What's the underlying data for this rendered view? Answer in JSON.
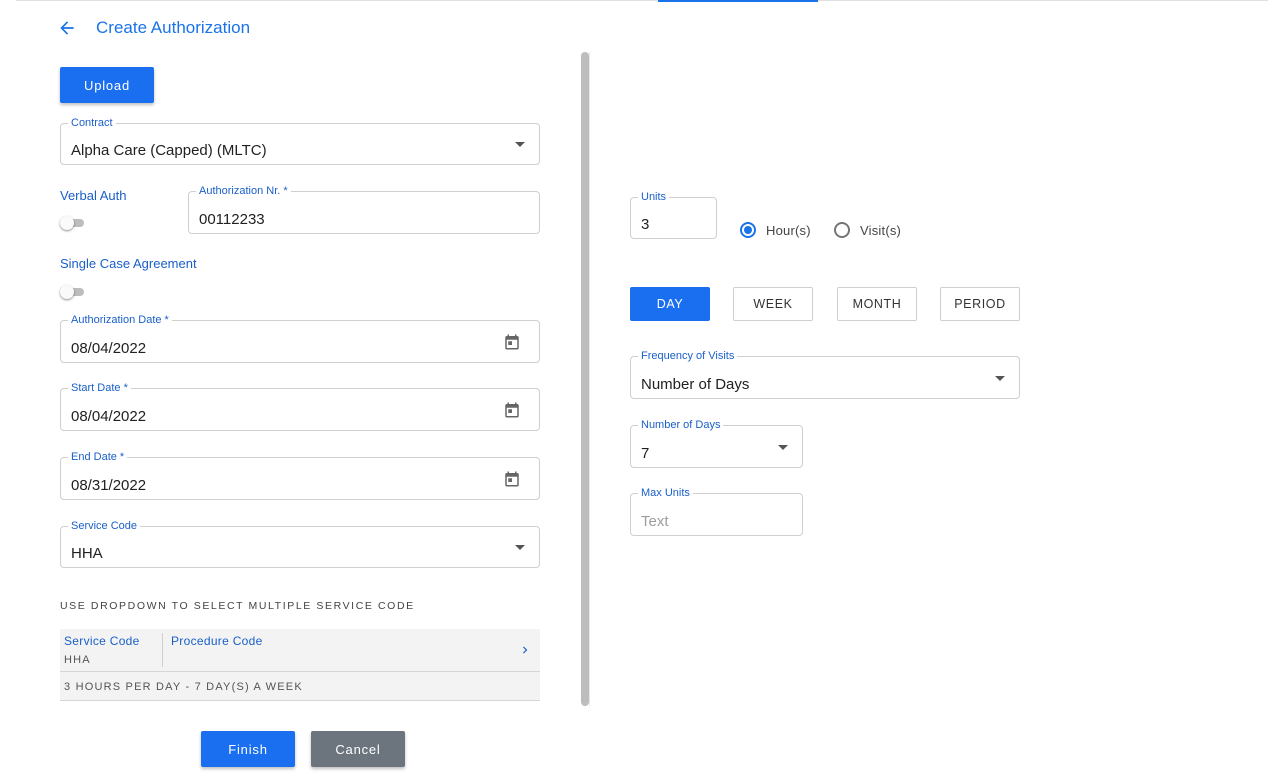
{
  "header": {
    "title": "Create Authorization",
    "back_icon": "arrow-left-icon"
  },
  "upload_label": "Upload",
  "contract": {
    "label": "Contract",
    "value": "Alpha Care (Capped) (MLTC)"
  },
  "verbal_auth": {
    "label": "Verbal Auth",
    "on": false
  },
  "auth_nr": {
    "label": "Authorization Nr. *",
    "value": "00112233"
  },
  "single_case": {
    "label": "Single Case Agreement",
    "on": false
  },
  "auth_date": {
    "label": "Authorization Date *",
    "value": "08/04/2022"
  },
  "start_date": {
    "label": "Start Date *",
    "value": "08/04/2022"
  },
  "end_date": {
    "label": "End Date *",
    "value": "08/31/2022"
  },
  "service_code": {
    "label": "Service Code",
    "value": "HHA"
  },
  "hint": "USE DROPDOWN TO SELECT MULTIPLE SERVICE CODE",
  "service_table": {
    "col_service": "Service Code",
    "col_procedure": "Procedure Code",
    "service_value": "HHA",
    "procedure_value": "",
    "summary": "3 HOURS PER DAY - 7 DAY(S) A WEEK"
  },
  "actions": {
    "finish": "Finish",
    "cancel": "Cancel"
  },
  "units": {
    "label": "Units",
    "value": "3"
  },
  "unit_type": {
    "hours": "Hour(s)",
    "visits": "Visit(s)",
    "selected": "hours"
  },
  "period_buttons": {
    "day": "DAY",
    "week": "WEEK",
    "month": "MONTH",
    "period": "PERIOD",
    "active": "day"
  },
  "frequency": {
    "label": "Frequency of Visits",
    "value": "Number of Days"
  },
  "number_of_days": {
    "label": "Number of Days",
    "value": "7"
  },
  "max_units": {
    "label": "Max Units",
    "placeholder": "Text"
  },
  "colors": {
    "primary": "#1a6ff0",
    "label_blue": "#1a5fc9",
    "cancel_grey": "#6c757d"
  }
}
